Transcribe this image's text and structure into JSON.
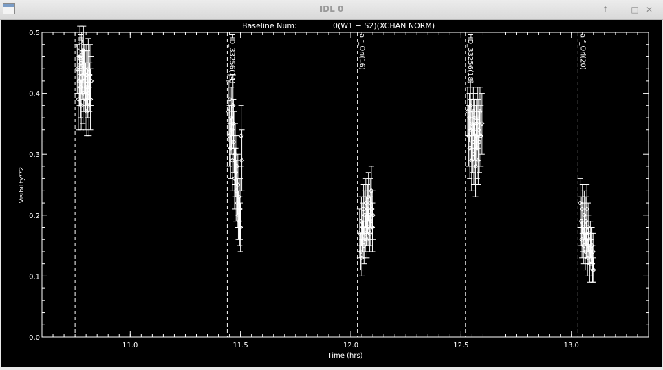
{
  "window": {
    "title": "IDL 0",
    "buttons": {
      "up": "↑",
      "minimize": "_",
      "maximize": "□",
      "close": "✕"
    }
  },
  "colors": {
    "background": "#000000",
    "foreground": "#ffffff"
  },
  "chart_data": {
    "type": "scatter",
    "title_left": "Baseline Num:",
    "title_right": "0(W1 − S2)(XCHAN NORM)",
    "xlabel": "Time (hrs)",
    "ylabel": "Visibility**2",
    "xlim": [
      10.6,
      13.35
    ],
    "ylim": [
      0.0,
      0.5
    ],
    "xticks": [
      "11.0",
      "11.5",
      "12.0",
      "12.5",
      "13.0"
    ],
    "xtick_values": [
      11.0,
      11.5,
      12.0,
      12.5,
      13.0
    ],
    "yticks": [
      "0.0",
      "0.1",
      "0.2",
      "0.3",
      "0.4",
      "0.5"
    ],
    "ytick_values": [
      0.0,
      0.1,
      0.2,
      0.3,
      0.4,
      0.5
    ],
    "grid": false,
    "error_bars": true,
    "marker": "diamond",
    "annotations": [
      {
        "text": "HD_25490(12)",
        "x": 10.75
      },
      {
        "text": "HD_33256(14)",
        "x": 11.44
      },
      {
        "text": "alf_Ori(16)",
        "x": 12.03
      },
      {
        "text": "HD_33256(18)",
        "x": 12.52
      },
      {
        "text": "alf_Ori(20)",
        "x": 13.03
      }
    ],
    "points": [
      {
        "x": 10.76,
        "y": 0.44,
        "e": 0.04
      },
      {
        "x": 10.765,
        "y": 0.39,
        "e": 0.05
      },
      {
        "x": 10.77,
        "y": 0.42,
        "e": 0.04
      },
      {
        "x": 10.772,
        "y": 0.46,
        "e": 0.05
      },
      {
        "x": 10.775,
        "y": 0.41,
        "e": 0.05
      },
      {
        "x": 10.778,
        "y": 0.38,
        "e": 0.04
      },
      {
        "x": 10.78,
        "y": 0.45,
        "e": 0.05
      },
      {
        "x": 10.783,
        "y": 0.43,
        "e": 0.04
      },
      {
        "x": 10.786,
        "y": 0.4,
        "e": 0.05
      },
      {
        "x": 10.788,
        "y": 0.47,
        "e": 0.04
      },
      {
        "x": 10.79,
        "y": 0.42,
        "e": 0.05
      },
      {
        "x": 10.793,
        "y": 0.44,
        "e": 0.04
      },
      {
        "x": 10.796,
        "y": 0.39,
        "e": 0.05
      },
      {
        "x": 10.798,
        "y": 0.41,
        "e": 0.04
      },
      {
        "x": 10.8,
        "y": 0.43,
        "e": 0.05
      },
      {
        "x": 10.803,
        "y": 0.37,
        "e": 0.04
      },
      {
        "x": 10.806,
        "y": 0.42,
        "e": 0.05
      },
      {
        "x": 10.808,
        "y": 0.4,
        "e": 0.04
      },
      {
        "x": 10.81,
        "y": 0.44,
        "e": 0.05
      },
      {
        "x": 10.813,
        "y": 0.38,
        "e": 0.05
      },
      {
        "x": 10.816,
        "y": 0.41,
        "e": 0.04
      },
      {
        "x": 10.818,
        "y": 0.43,
        "e": 0.05
      },
      {
        "x": 10.82,
        "y": 0.39,
        "e": 0.05
      },
      {
        "x": 10.823,
        "y": 0.42,
        "e": 0.04
      },
      {
        "x": 11.445,
        "y": 0.37,
        "e": 0.05
      },
      {
        "x": 11.45,
        "y": 0.33,
        "e": 0.05
      },
      {
        "x": 11.452,
        "y": 0.39,
        "e": 0.04
      },
      {
        "x": 11.455,
        "y": 0.31,
        "e": 0.05
      },
      {
        "x": 11.458,
        "y": 0.36,
        "e": 0.05
      },
      {
        "x": 11.46,
        "y": 0.34,
        "e": 0.04
      },
      {
        "x": 11.463,
        "y": 0.29,
        "e": 0.05
      },
      {
        "x": 11.466,
        "y": 0.38,
        "e": 0.05
      },
      {
        "x": 11.468,
        "y": 0.35,
        "e": 0.04
      },
      {
        "x": 11.47,
        "y": 0.32,
        "e": 0.05
      },
      {
        "x": 11.473,
        "y": 0.26,
        "e": 0.05
      },
      {
        "x": 11.476,
        "y": 0.3,
        "e": 0.05
      },
      {
        "x": 11.478,
        "y": 0.27,
        "e": 0.04
      },
      {
        "x": 11.48,
        "y": 0.24,
        "e": 0.05
      },
      {
        "x": 11.483,
        "y": 0.28,
        "e": 0.05
      },
      {
        "x": 11.486,
        "y": 0.22,
        "e": 0.04
      },
      {
        "x": 11.488,
        "y": 0.25,
        "e": 0.05
      },
      {
        "x": 11.49,
        "y": 0.2,
        "e": 0.04
      },
      {
        "x": 11.493,
        "y": 0.23,
        "e": 0.05
      },
      {
        "x": 11.496,
        "y": 0.19,
        "e": 0.04
      },
      {
        "x": 11.498,
        "y": 0.21,
        "e": 0.05
      },
      {
        "x": 11.5,
        "y": 0.18,
        "e": 0.04
      },
      {
        "x": 11.503,
        "y": 0.33,
        "e": 0.05
      },
      {
        "x": 11.506,
        "y": 0.29,
        "e": 0.05
      },
      {
        "x": 12.04,
        "y": 0.17,
        "e": 0.04
      },
      {
        "x": 12.045,
        "y": 0.14,
        "e": 0.03
      },
      {
        "x": 12.048,
        "y": 0.19,
        "e": 0.04
      },
      {
        "x": 12.05,
        "y": 0.13,
        "e": 0.03
      },
      {
        "x": 12.053,
        "y": 0.18,
        "e": 0.04
      },
      {
        "x": 12.056,
        "y": 0.16,
        "e": 0.03
      },
      {
        "x": 12.058,
        "y": 0.21,
        "e": 0.04
      },
      {
        "x": 12.06,
        "y": 0.15,
        "e": 0.03
      },
      {
        "x": 12.063,
        "y": 0.2,
        "e": 0.04
      },
      {
        "x": 12.066,
        "y": 0.17,
        "e": 0.03
      },
      {
        "x": 12.068,
        "y": 0.22,
        "e": 0.04
      },
      {
        "x": 12.07,
        "y": 0.19,
        "e": 0.04
      },
      {
        "x": 12.073,
        "y": 0.16,
        "e": 0.03
      },
      {
        "x": 12.076,
        "y": 0.21,
        "e": 0.04
      },
      {
        "x": 12.078,
        "y": 0.18,
        "e": 0.03
      },
      {
        "x": 12.08,
        "y": 0.23,
        "e": 0.04
      },
      {
        "x": 12.083,
        "y": 0.2,
        "e": 0.04
      },
      {
        "x": 12.086,
        "y": 0.17,
        "e": 0.03
      },
      {
        "x": 12.088,
        "y": 0.22,
        "e": 0.04
      },
      {
        "x": 12.09,
        "y": 0.19,
        "e": 0.04
      },
      {
        "x": 12.093,
        "y": 0.24,
        "e": 0.04
      },
      {
        "x": 12.096,
        "y": 0.21,
        "e": 0.03
      },
      {
        "x": 12.098,
        "y": 0.18,
        "e": 0.04
      },
      {
        "x": 12.1,
        "y": 0.2,
        "e": 0.04
      },
      {
        "x": 12.53,
        "y": 0.37,
        "e": 0.04
      },
      {
        "x": 12.535,
        "y": 0.33,
        "e": 0.05
      },
      {
        "x": 12.538,
        "y": 0.36,
        "e": 0.04
      },
      {
        "x": 12.54,
        "y": 0.31,
        "e": 0.05
      },
      {
        "x": 12.543,
        "y": 0.38,
        "e": 0.04
      },
      {
        "x": 12.546,
        "y": 0.34,
        "e": 0.05
      },
      {
        "x": 12.548,
        "y": 0.29,
        "e": 0.05
      },
      {
        "x": 12.55,
        "y": 0.35,
        "e": 0.04
      },
      {
        "x": 12.553,
        "y": 0.32,
        "e": 0.05
      },
      {
        "x": 12.556,
        "y": 0.37,
        "e": 0.04
      },
      {
        "x": 12.558,
        "y": 0.3,
        "e": 0.05
      },
      {
        "x": 12.56,
        "y": 0.34,
        "e": 0.05
      },
      {
        "x": 12.563,
        "y": 0.36,
        "e": 0.04
      },
      {
        "x": 12.566,
        "y": 0.28,
        "e": 0.05
      },
      {
        "x": 12.568,
        "y": 0.33,
        "e": 0.05
      },
      {
        "x": 12.57,
        "y": 0.35,
        "e": 0.04
      },
      {
        "x": 12.573,
        "y": 0.31,
        "e": 0.05
      },
      {
        "x": 12.576,
        "y": 0.36,
        "e": 0.05
      },
      {
        "x": 12.578,
        "y": 0.29,
        "e": 0.04
      },
      {
        "x": 12.58,
        "y": 0.34,
        "e": 0.05
      },
      {
        "x": 12.583,
        "y": 0.32,
        "e": 0.05
      },
      {
        "x": 12.586,
        "y": 0.37,
        "e": 0.04
      },
      {
        "x": 12.59,
        "y": 0.33,
        "e": 0.05
      },
      {
        "x": 12.595,
        "y": 0.35,
        "e": 0.05
      },
      {
        "x": 13.04,
        "y": 0.22,
        "e": 0.04
      },
      {
        "x": 13.045,
        "y": 0.19,
        "e": 0.04
      },
      {
        "x": 13.048,
        "y": 0.16,
        "e": 0.03
      },
      {
        "x": 13.05,
        "y": 0.21,
        "e": 0.04
      },
      {
        "x": 13.053,
        "y": 0.18,
        "e": 0.04
      },
      {
        "x": 13.056,
        "y": 0.15,
        "e": 0.03
      },
      {
        "x": 13.058,
        "y": 0.2,
        "e": 0.04
      },
      {
        "x": 13.06,
        "y": 0.17,
        "e": 0.03
      },
      {
        "x": 13.063,
        "y": 0.14,
        "e": 0.03
      },
      {
        "x": 13.066,
        "y": 0.19,
        "e": 0.04
      },
      {
        "x": 13.068,
        "y": 0.16,
        "e": 0.03
      },
      {
        "x": 13.07,
        "y": 0.21,
        "e": 0.04
      },
      {
        "x": 13.073,
        "y": 0.13,
        "e": 0.03
      },
      {
        "x": 13.076,
        "y": 0.18,
        "e": 0.04
      },
      {
        "x": 13.078,
        "y": 0.15,
        "e": 0.03
      },
      {
        "x": 13.08,
        "y": 0.17,
        "e": 0.03
      },
      {
        "x": 13.083,
        "y": 0.12,
        "e": 0.03
      },
      {
        "x": 13.086,
        "y": 0.16,
        "e": 0.03
      },
      {
        "x": 13.088,
        "y": 0.14,
        "e": 0.03
      },
      {
        "x": 13.09,
        "y": 0.13,
        "e": 0.03
      },
      {
        "x": 13.093,
        "y": 0.15,
        "e": 0.03
      },
      {
        "x": 13.096,
        "y": 0.12,
        "e": 0.03
      },
      {
        "x": 13.098,
        "y": 0.14,
        "e": 0.03
      },
      {
        "x": 13.1,
        "y": 0.11,
        "e": 0.02
      }
    ]
  }
}
